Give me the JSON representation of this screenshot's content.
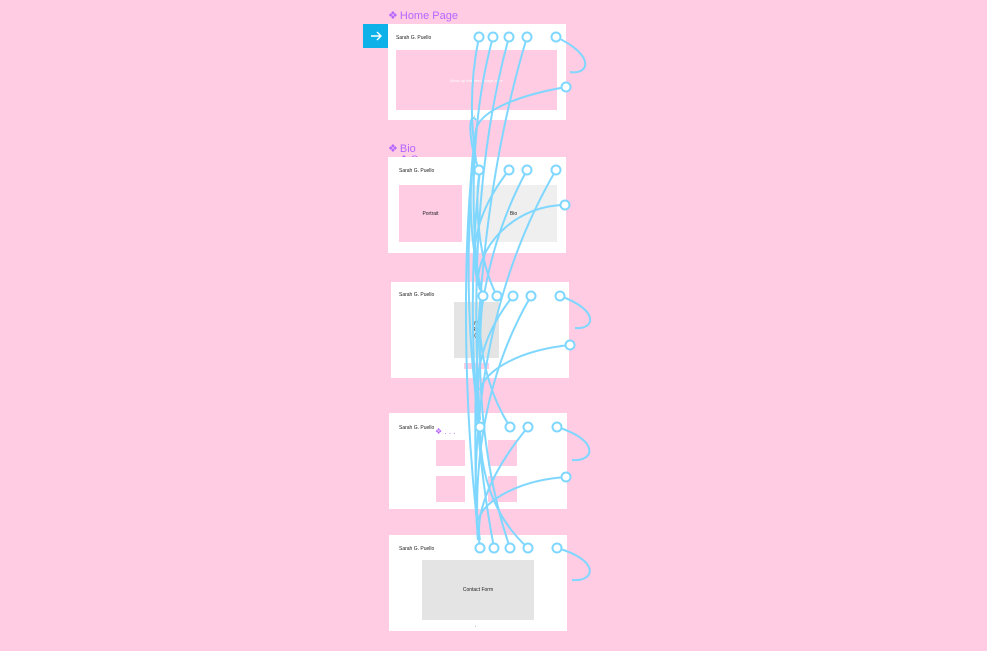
{
  "frames": {
    "home": {
      "label": "Home Page",
      "label_glyph": "❖",
      "site_name": "Sarah G. Puello",
      "hero_text": "Mock up this hero image here"
    },
    "bio": {
      "label": "Bio",
      "label_glyph": "❖",
      "sub_label": "S…",
      "site_name": "Sarah G. Puello",
      "portrait_label": "Portrait",
      "bio_label": "Bio"
    },
    "work": {
      "site_name": "Sarah G. Puello",
      "work_lines": [
        "Wh",
        "Res",
        "(h"
      ]
    },
    "portfolio": {
      "site_name": "Sarah G. Puello",
      "component_label": "❖ . . ."
    },
    "contact": {
      "site_name": "Sarah G. Puello",
      "form_label": "Contact Form"
    }
  },
  "colors": {
    "canvas": "#ffcce3",
    "frame": "#ffffff",
    "placeholder_pink": "#ffcce3",
    "placeholder_grey": "#efefef",
    "wire": "#7fd7ff",
    "label_purple": "#b666ff",
    "play_button": "#0fb2e8"
  },
  "icons": {
    "play": "arrow-right-icon",
    "component": "component-diamond-icon"
  }
}
